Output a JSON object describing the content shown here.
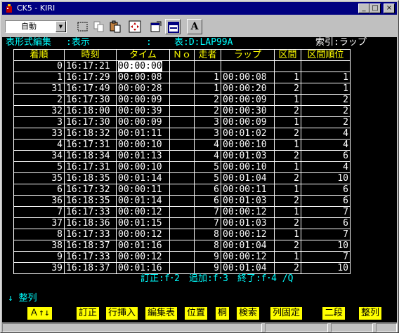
{
  "window": {
    "title": "CK5 - KIRI",
    "minimize_glyph": "_",
    "maximize_glyph": "□",
    "close_glyph": "×"
  },
  "toolbar": {
    "mode_select": {
      "value": "自動"
    },
    "letter_button": "A",
    "icons": [
      "select-rect-icon",
      "copy-icon",
      "paste-icon",
      "move-icon",
      "properties-icon",
      "window-layout-icon",
      "font-icon"
    ]
  },
  "terminal": {
    "header_left": "表形式編集",
    "header_mode": ":表示",
    "header_colon": ":",
    "header_table": "表:D:LAP99A",
    "header_index": "索引:ラップ",
    "columns": [
      "着順",
      "時刻",
      "タイム",
      "Ｎｏ",
      "走者",
      "ラップ",
      "区間",
      "区間順位"
    ],
    "rows": [
      {
        "rank": "0",
        "time": "16:17:21",
        "taim": "00:00:00",
        "no": "",
        "runner": "",
        "lap": "",
        "section": "",
        "section_rank": ""
      },
      {
        "rank": "1",
        "time": "16:17:29",
        "taim": "00:00:08",
        "no": "",
        "runner": "1",
        "lap": "00:00:08",
        "section": "1",
        "section_rank": "1"
      },
      {
        "rank": "31",
        "time": "16:17:49",
        "taim": "00:00:28",
        "no": "",
        "runner": "1",
        "lap": "00:00:20",
        "section": "2",
        "section_rank": "1"
      },
      {
        "rank": "2",
        "time": "16:17:30",
        "taim": "00:00:09",
        "no": "",
        "runner": "2",
        "lap": "00:00:09",
        "section": "1",
        "section_rank": "2"
      },
      {
        "rank": "32",
        "time": "16:18:00",
        "taim": "00:00:39",
        "no": "",
        "runner": "2",
        "lap": "00:00:30",
        "section": "2",
        "section_rank": "2"
      },
      {
        "rank": "3",
        "time": "16:17:30",
        "taim": "00:00:09",
        "no": "",
        "runner": "3",
        "lap": "00:00:09",
        "section": "1",
        "section_rank": "2"
      },
      {
        "rank": "33",
        "time": "16:18:32",
        "taim": "00:01:11",
        "no": "",
        "runner": "3",
        "lap": "00:01:02",
        "section": "2",
        "section_rank": "4"
      },
      {
        "rank": "4",
        "time": "16:17:31",
        "taim": "00:00:10",
        "no": "",
        "runner": "4",
        "lap": "00:00:10",
        "section": "1",
        "section_rank": "4"
      },
      {
        "rank": "34",
        "time": "16:18:34",
        "taim": "00:01:13",
        "no": "",
        "runner": "4",
        "lap": "00:01:03",
        "section": "2",
        "section_rank": "6"
      },
      {
        "rank": "5",
        "time": "16:17:31",
        "taim": "00:00:10",
        "no": "",
        "runner": "5",
        "lap": "00:00:10",
        "section": "1",
        "section_rank": "4"
      },
      {
        "rank": "35",
        "time": "16:18:35",
        "taim": "00:01:14",
        "no": "",
        "runner": "5",
        "lap": "00:01:04",
        "section": "2",
        "section_rank": "10"
      },
      {
        "rank": "6",
        "time": "16:17:32",
        "taim": "00:00:11",
        "no": "",
        "runner": "6",
        "lap": "00:00:11",
        "section": "1",
        "section_rank": "6"
      },
      {
        "rank": "36",
        "time": "16:18:35",
        "taim": "00:01:14",
        "no": "",
        "runner": "6",
        "lap": "00:01:03",
        "section": "2",
        "section_rank": "6"
      },
      {
        "rank": "7",
        "time": "16:17:33",
        "taim": "00:00:12",
        "no": "",
        "runner": "7",
        "lap": "00:00:12",
        "section": "1",
        "section_rank": "7"
      },
      {
        "rank": "37",
        "time": "16:18:36",
        "taim": "00:01:15",
        "no": "",
        "runner": "7",
        "lap": "00:01:03",
        "section": "2",
        "section_rank": "6"
      },
      {
        "rank": "8",
        "time": "16:17:33",
        "taim": "00:00:12",
        "no": "",
        "runner": "8",
        "lap": "00:00:12",
        "section": "1",
        "section_rank": "7"
      },
      {
        "rank": "38",
        "time": "16:18:37",
        "taim": "00:01:16",
        "no": "",
        "runner": "8",
        "lap": "00:01:04",
        "section": "2",
        "section_rank": "10"
      },
      {
        "rank": "9",
        "time": "16:17:33",
        "taim": "00:00:12",
        "no": "",
        "runner": "9",
        "lap": "00:00:12",
        "section": "1",
        "section_rank": "7"
      },
      {
        "rank": "39",
        "time": "16:18:37",
        "taim": "00:01:16",
        "no": "",
        "runner": "9",
        "lap": "00:01:04",
        "section": "2",
        "section_rank": "10"
      }
    ],
    "hint_line": "訂正:f･2　追加:f･3　終了:f･4 /Q",
    "prompt_line": "↓ 整列",
    "function_keys": [
      "Ａ↑↓",
      "訂正",
      "行挿入",
      "編集表",
      "位置",
      "桐",
      "検索",
      "列固定",
      "二段",
      "整列"
    ],
    "colors": {
      "background": "#000000",
      "text": "#ffffff",
      "header": "#00ffff",
      "column_header": "#ffff00",
      "fkey_bg": "#ffff00"
    }
  }
}
